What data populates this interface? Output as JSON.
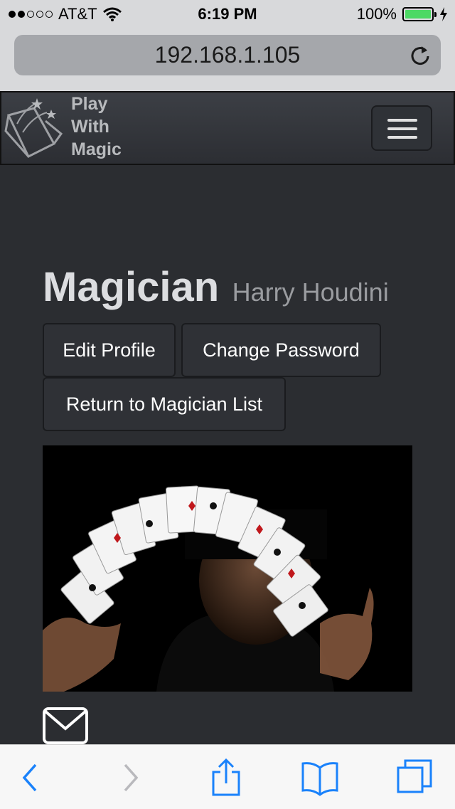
{
  "status_bar": {
    "carrier": "AT&T",
    "time": "6:19 PM",
    "battery_percent": "100%",
    "signal_bars_filled": 2,
    "signal_bars_total": 5,
    "battery_color": "#4cd964"
  },
  "browser": {
    "url": "192.168.1.105",
    "reload_icon": "reload-icon"
  },
  "navbar": {
    "brand_name": "Play\nWith\nMagic",
    "logo_icon": "magic-book-logo",
    "menu_icon": "hamburger-menu-icon"
  },
  "profile": {
    "title": "Magician",
    "name": "Harry Houdini",
    "buttons": {
      "edit_profile": "Edit Profile",
      "change_password": "Change Password",
      "return_list": "Return to Magician List"
    },
    "photo_subject": "magician-card-fan-photo",
    "contact_icon": "envelope-icon"
  },
  "toolbar": {
    "icons": [
      "back-icon",
      "forward-icon",
      "share-icon",
      "bookmarks-icon",
      "tabs-icon"
    ],
    "accent_color": "#1a82fb",
    "disabled_color": "#b9b9bd"
  }
}
